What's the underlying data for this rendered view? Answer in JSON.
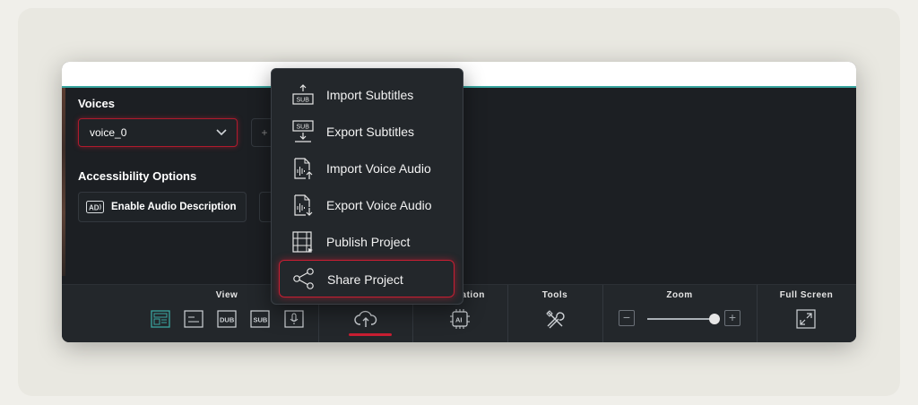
{
  "voices": {
    "title": "Voices",
    "selected": "voice_0",
    "add_label": "+"
  },
  "accessibility": {
    "title": "Accessibility Options",
    "enable_audio_description": "Enable Audio Description",
    "ad_badge": "AD"
  },
  "share_menu": {
    "items": [
      {
        "label": "Import Subtitles",
        "icon": "import-subtitles-icon"
      },
      {
        "label": "Export Subtitles",
        "icon": "export-subtitles-icon"
      },
      {
        "label": "Import Voice Audio",
        "icon": "import-voice-audio-icon"
      },
      {
        "label": "Export Voice Audio",
        "icon": "export-voice-audio-icon"
      },
      {
        "label": "Publish Project",
        "icon": "publish-project-icon"
      },
      {
        "label": "Share Project",
        "icon": "share-icon",
        "highlighted": true
      }
    ]
  },
  "toolbar": {
    "view": {
      "title": "View",
      "buttons": [
        "layout-icon",
        "subtitle-lines-icon",
        "DUB",
        "SUB",
        "microphone-icon"
      ]
    },
    "share": {
      "icon": "cloud-upload-icon",
      "active": true
    },
    "automation": {
      "title": "mation",
      "icon_text": "AI"
    },
    "tools": {
      "title": "Tools",
      "icon": "tools-icon"
    },
    "zoom": {
      "title": "Zoom",
      "minus": "−",
      "plus": "+",
      "level": 0.93
    },
    "fullscreen": {
      "title": "Full Screen",
      "icon": "expand-icon"
    }
  },
  "colors": {
    "accent_red": "#c81e32",
    "accent_teal": "#3aa6a0",
    "panel_bg": "#1c1f23"
  }
}
